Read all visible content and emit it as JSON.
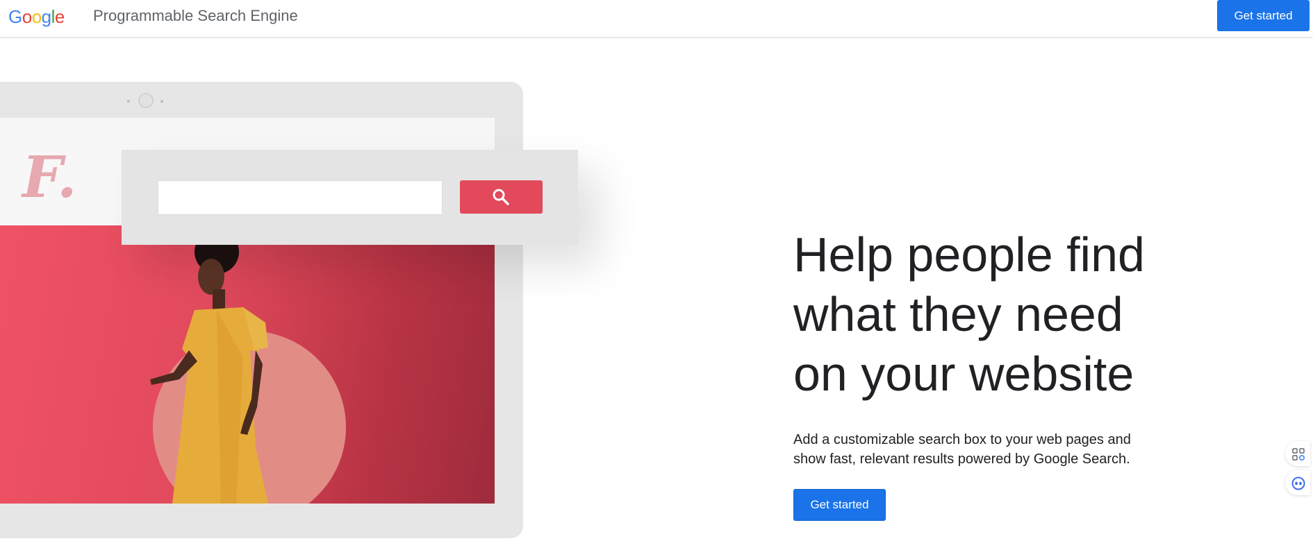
{
  "header": {
    "logo_letters": [
      "G",
      "o",
      "o",
      "g",
      "l",
      "e"
    ],
    "logo_colors": [
      "#4285F4",
      "#EA4335",
      "#FBBC05",
      "#4285F4",
      "#34A853",
      "#EA4335"
    ],
    "product_name": "Programmable Search Engine",
    "get_started_label": "Get started"
  },
  "illustration": {
    "brand_mark": "F.",
    "search_icon": "search-icon",
    "accent_color": "#e2495b"
  },
  "hero": {
    "headline_lines": [
      "Help people find",
      "what they need",
      "on your website"
    ],
    "subtext": "Add a customizable search box to your web pages and show fast, relevant results powered by Google Search.",
    "cta_label": "Get started",
    "cta_color": "#1a73e8"
  },
  "side_widgets": [
    "apps-grid-icon",
    "assistant-bot-icon"
  ]
}
